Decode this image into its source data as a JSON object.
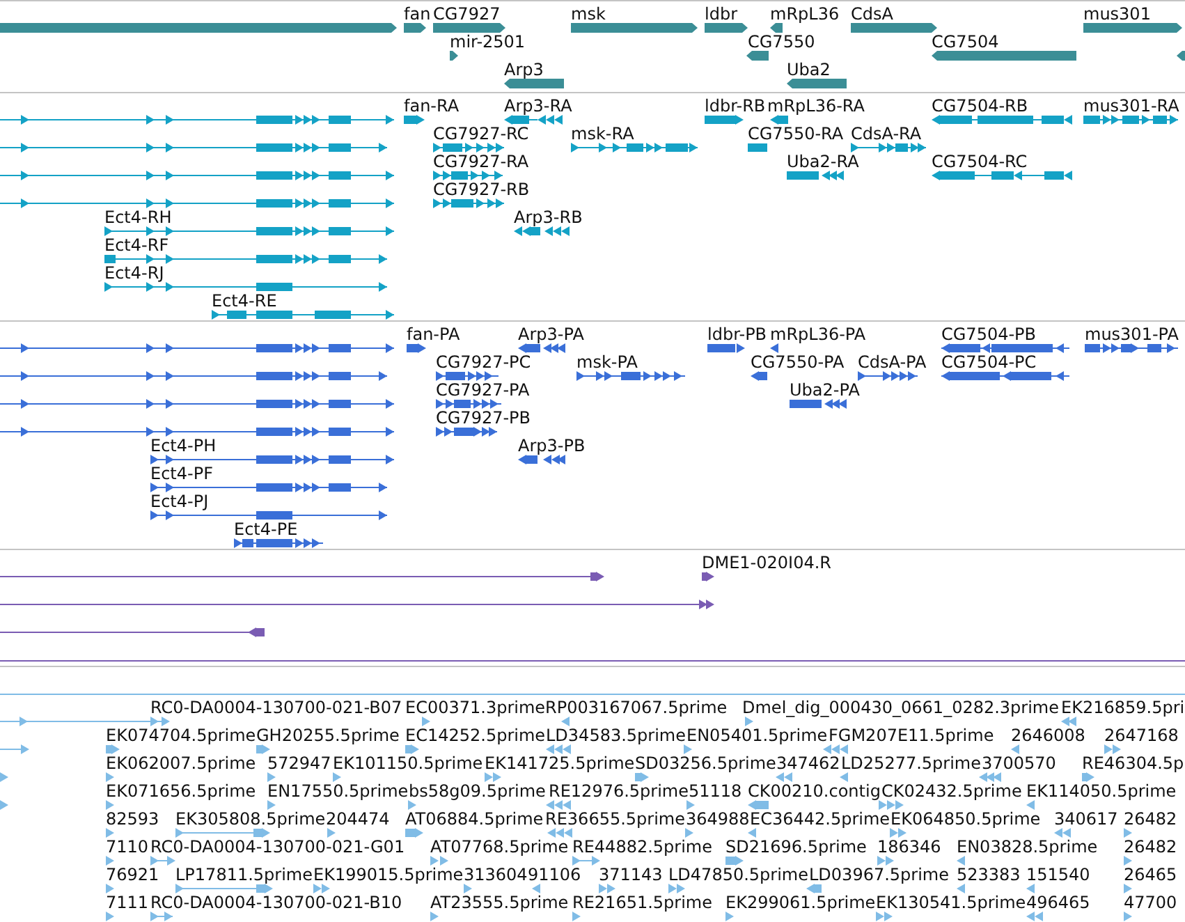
{
  "tracks": [
    {
      "kind": "gene",
      "features": [
        {
          "reverse": false
        },
        {
          "label": "fan",
          "reverse": false
        },
        {
          "label": "CG7927",
          "reverse": false
        },
        {
          "label": "msk",
          "reverse": false
        },
        {
          "label": "ldbr",
          "reverse": false
        },
        {
          "label": "mRpL36",
          "reverse": true
        },
        {
          "label": "CdsA",
          "reverse": false
        },
        {
          "label": "mus301",
          "reverse": false
        },
        {
          "label": "mir-2501",
          "reverse": false
        },
        {
          "label": "CG7550",
          "reverse": true
        },
        {
          "label": "CG7504",
          "reverse": true
        },
        {
          "reverse": true
        },
        {
          "label": "Arp3",
          "reverse": true
        },
        {
          "label": "Uba2",
          "reverse": true
        }
      ]
    },
    {
      "kind": "transcript",
      "features": [
        {
          "reverse": false
        },
        {
          "label": "fan-RA",
          "reverse": false
        },
        {
          "label": "Arp3-RA",
          "reverse": true
        },
        {
          "label": "ldbr-RB",
          "reverse": false
        },
        {
          "label": "mRpL36-RA",
          "reverse": true
        },
        {
          "label": "CG7504-RB",
          "reverse": true
        },
        {
          "label": "mus301-RA",
          "reverse": false
        },
        {
          "reverse": false
        },
        {
          "label": "CG7927-RC",
          "reverse": false
        },
        {
          "label": "msk-RA",
          "reverse": false
        },
        {
          "label": "CG7550-RA"
        },
        {
          "label": "CdsA-RA",
          "reverse": false
        },
        {
          "reverse": false
        },
        {
          "label": "CG7927-RA",
          "reverse": false
        },
        {
          "label": "Uba2-RA",
          "reverse": true
        },
        {
          "label": "CG7504-RC",
          "reverse": true
        },
        {
          "reverse": false
        },
        {
          "label": "CG7927-RB",
          "reverse": false
        },
        {
          "label": "Ect4-RH",
          "reverse": false
        },
        {
          "label": "Arp3-RB",
          "reverse": true
        },
        {
          "label": "Ect4-RF",
          "reverse": false
        },
        {
          "label": "Ect4-RJ",
          "reverse": false
        },
        {
          "label": "Ect4-RE",
          "reverse": false
        }
      ]
    },
    {
      "kind": "protein",
      "features": [
        {
          "reverse": false
        },
        {
          "label": "fan-PA",
          "reverse": false
        },
        {
          "label": "Arp3-PA",
          "reverse": true
        },
        {
          "label": "ldbr-PB",
          "reverse": false
        },
        {
          "label": "mRpL36-PA",
          "reverse": true
        },
        {
          "label": "CG7504-PB",
          "reverse": true
        },
        {
          "label": "mus301-PA",
          "reverse": false
        },
        {
          "reverse": false
        },
        {
          "label": "CG7927-PC",
          "reverse": false
        },
        {
          "label": "msk-PA",
          "reverse": false
        },
        {
          "label": "CG7550-PA",
          "reverse": true
        },
        {
          "label": "CdsA-PA",
          "reverse": false
        },
        {
          "label": "CG7504-PC",
          "reverse": true
        },
        {
          "reverse": false
        },
        {
          "label": "CG7927-PA",
          "reverse": false
        },
        {
          "label": "Uba2-PA",
          "reverse": true
        },
        {
          "reverse": false
        },
        {
          "label": "CG7927-PB",
          "reverse": false
        },
        {
          "label": "Ect4-PH",
          "reverse": false
        },
        {
          "label": "Arp3-PB",
          "reverse": true
        },
        {
          "label": "Ect4-PF",
          "reverse": false
        },
        {
          "label": "Ect4-PJ",
          "reverse": false
        },
        {
          "label": "Ect4-PE",
          "reverse": false
        }
      ]
    },
    {
      "kind": "clone",
      "full_width_feature": true,
      "features": [
        {
          "reverse": false
        },
        {
          "label": "DME1-020I04.R",
          "reverse": false
        },
        {
          "reverse": false
        },
        {
          "reverse": true
        }
      ]
    },
    {
      "kind": "est",
      "full_width_feature": true,
      "features": [
        {
          "label": "RC0-DA0004-130700-021-B07",
          "reverse": false
        },
        {
          "label": "EC00371.3prime",
          "reverse": false
        },
        {
          "label": "RP003167067.5prime",
          "reverse": true
        },
        {
          "label": "Dmel_dig_000430_0661_0282.3prime",
          "reverse": false
        },
        {
          "label": "EK216859.5pri",
          "reverse": true
        },
        {
          "reverse": false
        },
        {
          "label": "EK074704.5prime",
          "reverse": false
        },
        {
          "label": "GH20255.5prime",
          "reverse": false
        },
        {
          "label": "EC14252.5prime",
          "reverse": false
        },
        {
          "label": "LD34583.5prime",
          "reverse": true
        },
        {
          "label": "EN05401.5prime",
          "reverse": false
        },
        {
          "label": "FGM207E11.5prime",
          "reverse": true
        },
        {
          "label": "2646008",
          "reverse": true
        },
        {
          "label": "2647168",
          "reverse": false
        },
        {
          "reverse": false
        },
        {
          "label": "EK062007.5prime",
          "reverse": false
        },
        {
          "label": "572947",
          "reverse": false
        },
        {
          "label": "EK101150.5prime",
          "reverse": false
        },
        {
          "label": "EK141725.5prime",
          "reverse": false
        },
        {
          "label": "SD03256.5prime",
          "reverse": false
        },
        {
          "label": "347462",
          "reverse": true
        },
        {
          "label": "LD25277.5prime",
          "reverse": true
        },
        {
          "label": "3700570",
          "reverse": true
        },
        {
          "label": "RE46304.5p",
          "reverse": false
        },
        {
          "reverse": false
        },
        {
          "label": "EK071656.5prime",
          "reverse": false
        },
        {
          "label": "EN17550.5prime",
          "reverse": false
        },
        {
          "label": "bs58g09.5prime",
          "reverse": false
        },
        {
          "label": "RE12976.5prime",
          "reverse": true
        },
        {
          "label": "51118",
          "reverse": false
        },
        {
          "label": "CK00210.contig",
          "reverse": true
        },
        {
          "label": "CK02432.5prime",
          "reverse": false
        },
        {
          "label": "EK114050.5prime",
          "reverse": true
        },
        {
          "label": "82593",
          "reverse": false
        },
        {
          "label": "EK305808.5prime",
          "reverse": false
        },
        {
          "label": "204474",
          "reverse": false
        },
        {
          "label": "AT06884.5prime",
          "reverse": false
        },
        {
          "label": "RE36655.5prime",
          "reverse": true
        },
        {
          "label": "364988",
          "reverse": false
        },
        {
          "label": "EC36442.5prime",
          "reverse": true
        },
        {
          "label": "EK064850.5prime",
          "reverse": false
        },
        {
          "label": "340617",
          "reverse": true
        },
        {
          "label": "26482",
          "reverse": false
        },
        {
          "label": "7110",
          "reverse": false
        },
        {
          "label": "RC0-DA0004-130700-021-G01",
          "reverse": false
        },
        {
          "label": "AT07768.5prime",
          "reverse": false
        },
        {
          "label": "RE44882.5prime",
          "reverse": false
        },
        {
          "label": "SD21696.5prime",
          "reverse": false
        },
        {
          "label": "186346",
          "reverse": false
        },
        {
          "label": "EN03828.5prime",
          "reverse": true
        },
        {
          "label": "26482",
          "reverse": false
        },
        {
          "label": "76921",
          "reverse": false
        },
        {
          "label": "LP17811.5prime",
          "reverse": false
        },
        {
          "label": "EK199015.5prime",
          "reverse": false
        },
        {
          "label": "313604",
          "reverse": false
        },
        {
          "label": "91106",
          "reverse": true
        },
        {
          "label": "371143",
          "reverse": false
        },
        {
          "label": "LD47850.5prime",
          "reverse": false
        },
        {
          "label": "LD03967.5prime",
          "reverse": true
        },
        {
          "label": "523383",
          "reverse": true
        },
        {
          "label": "151540",
          "reverse": true
        },
        {
          "label": "26465",
          "reverse": false
        },
        {
          "label": "7111",
          "reverse": false
        },
        {
          "label": "RC0-DA0004-130700-021-B10",
          "reverse": false
        },
        {
          "label": "AT23555.5prime",
          "reverse": false
        },
        {
          "label": "RE21651.5prime",
          "reverse": false
        },
        {
          "label": "EK299061.5prime",
          "reverse": false
        },
        {
          "label": "EK130541.5prime",
          "reverse": false
        },
        {
          "label": "496465",
          "reverse": true
        },
        {
          "label": "47700",
          "reverse": false
        }
      ]
    }
  ]
}
